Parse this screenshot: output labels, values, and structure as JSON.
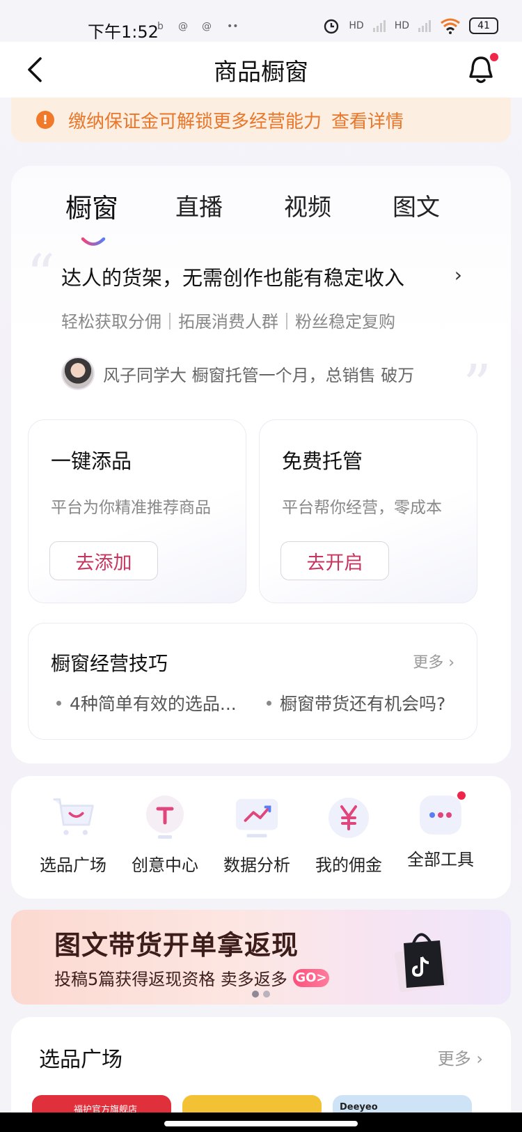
{
  "status_bar": {
    "time": "下午1:52",
    "mini_icons": [
      "b",
      "@",
      "@",
      "••"
    ],
    "network": [
      "HD",
      "HD"
    ],
    "battery": "41"
  },
  "nav": {
    "title": "商品橱窗",
    "has_notification_dot": true
  },
  "notice": {
    "icon": "!",
    "text": "缴纳保证金可解锁更多经营能力",
    "link": "查看详情"
  },
  "tabs": [
    {
      "label": "橱窗",
      "active": true
    },
    {
      "label": "直播",
      "active": false
    },
    {
      "label": "视频",
      "active": false
    },
    {
      "label": "图文",
      "active": false
    }
  ],
  "intro": {
    "headline": "达人的货架，无需创作也能有稳定收入",
    "chevron": "›",
    "subline": "轻松获取分佣｜拓展消费人群｜粉丝稳定复购",
    "testimonial": "风子同学大 橱窗托管一个月，总销售 破万"
  },
  "features": [
    {
      "title": "一键添品",
      "desc": "平台为你精准推荐商品",
      "button": "去添加"
    },
    {
      "title": "免费托管",
      "desc": "平台帮你经营，零成本",
      "button": "去开启"
    }
  ],
  "tips": {
    "title": "橱窗经营技巧",
    "more": "更多 ›",
    "items": [
      "4种简单有效的选品...",
      "橱窗带货还有机会吗?"
    ]
  },
  "tools": [
    {
      "label": "选品广场",
      "icon": "cart-icon",
      "badge": false
    },
    {
      "label": "创意中心",
      "icon": "bulb-icon",
      "badge": false
    },
    {
      "label": "数据分析",
      "icon": "chart-icon",
      "badge": false
    },
    {
      "label": "我的佣金",
      "icon": "yen-icon",
      "badge": false
    },
    {
      "label": "全部工具",
      "icon": "more-icon",
      "badge": true
    }
  ],
  "banner": {
    "title": "图文带货开单拿返现",
    "subtitle": "投稿5篇获得返现资格 卖多返多",
    "go": "GO>",
    "pages": 2,
    "active_page": 0
  },
  "section": {
    "title": "选品广场",
    "more": "更多 ›",
    "products": [
      {
        "tag": "福护官方旗舰店",
        "color": "#e0303b"
      },
      {
        "tag": "",
        "color": "#f3c234"
      },
      {
        "tag": "Deeyeo",
        "color": "#cfe3f7"
      }
    ]
  }
}
